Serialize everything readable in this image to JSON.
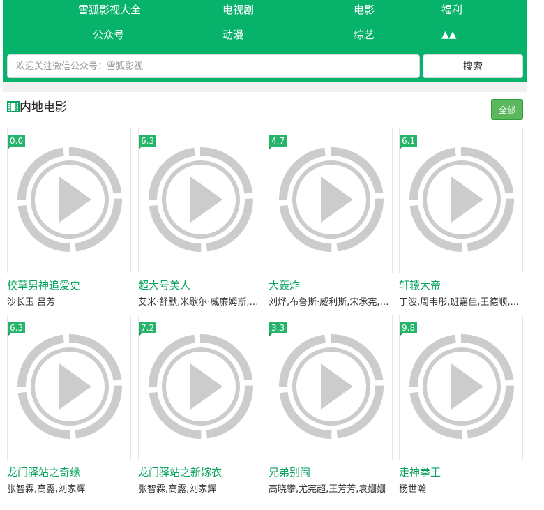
{
  "nav": {
    "items": [
      {
        "label": "雪狐影视大全"
      },
      {
        "label": "电视剧"
      },
      {
        "label": "电影"
      },
      {
        "label": "福利"
      },
      {
        "label": "公众号"
      },
      {
        "label": "动漫"
      },
      {
        "label": "综艺"
      },
      {
        "label": "▲▲"
      }
    ]
  },
  "search": {
    "placeholder": "欢迎关注微信公众号：雪狐影视",
    "value": "",
    "button_label": "搜索"
  },
  "section": {
    "icon": "film-icon",
    "title": "内地电影",
    "more_label": "全部"
  },
  "movies": [
    {
      "rating": "0.0",
      "title": "校草男神追爱史",
      "cast": "沙长玉 吕芳"
    },
    {
      "rating": "6.3",
      "title": "超大号美人",
      "cast": "艾米·舒默,米歇尔·威廉姆斯,艾米莉·拉塔科斯基"
    },
    {
      "rating": "4.7",
      "title": "大轰炸",
      "cast": "刘烨,布鲁斯·威利斯,宋承宪,范冰冰"
    },
    {
      "rating": "6.1",
      "title": "轩辕大帝",
      "cast": "于波,周韦彤,班嘉佳,王德顺,于承惠"
    },
    {
      "rating": "6.3",
      "title": "龙门驿站之奇缘",
      "cast": "张智霖,高露,刘家辉"
    },
    {
      "rating": "7.2",
      "title": "龙门驿站之新嫁衣",
      "cast": "张智霖,高露,刘家辉"
    },
    {
      "rating": "3.3",
      "title": "兄弟别闹",
      "cast": "高晓攀,尤宪超,王芳芳,袁姗姗"
    },
    {
      "rating": "9.8",
      "title": "走神拳王",
      "cast": "杨世瀚"
    }
  ],
  "colors": {
    "brand_green": "#07b26b",
    "title_green": "#07a35e",
    "rating_green": "#26b36a",
    "button_green": "#5cb85c"
  }
}
